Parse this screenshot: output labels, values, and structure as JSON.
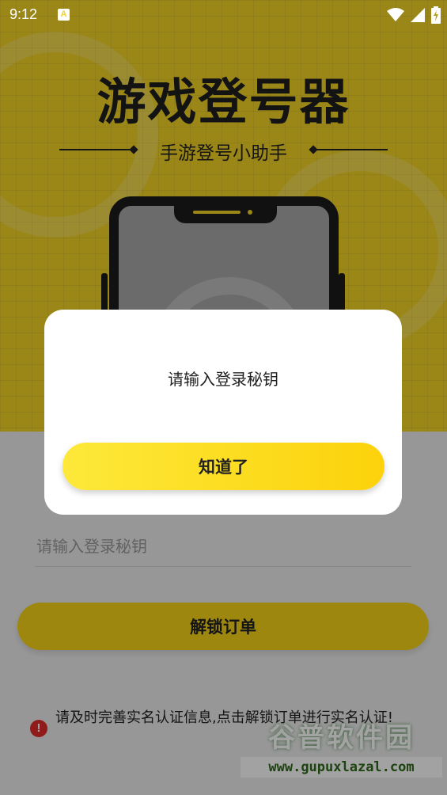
{
  "status_bar": {
    "time": "9:12",
    "notification_letter": "A"
  },
  "hero": {
    "title": "游戏登号器",
    "subtitle": "手游登号小助手"
  },
  "form": {
    "key_placeholder": "请输入登录秘钥",
    "unlock_label": "解锁订单"
  },
  "notice": {
    "text": "请及时完善实名认证信息,点击解锁订单进行实名认证!"
  },
  "watermark": {
    "brand": "谷普软件园",
    "url": "www.gupuxlazal.com"
  },
  "dialog": {
    "message": "请输入登录秘钥",
    "confirm_label": "知道了"
  },
  "colors": {
    "accent": "#f2d326",
    "button": "#f6d318",
    "warning": "#e02b2b"
  }
}
